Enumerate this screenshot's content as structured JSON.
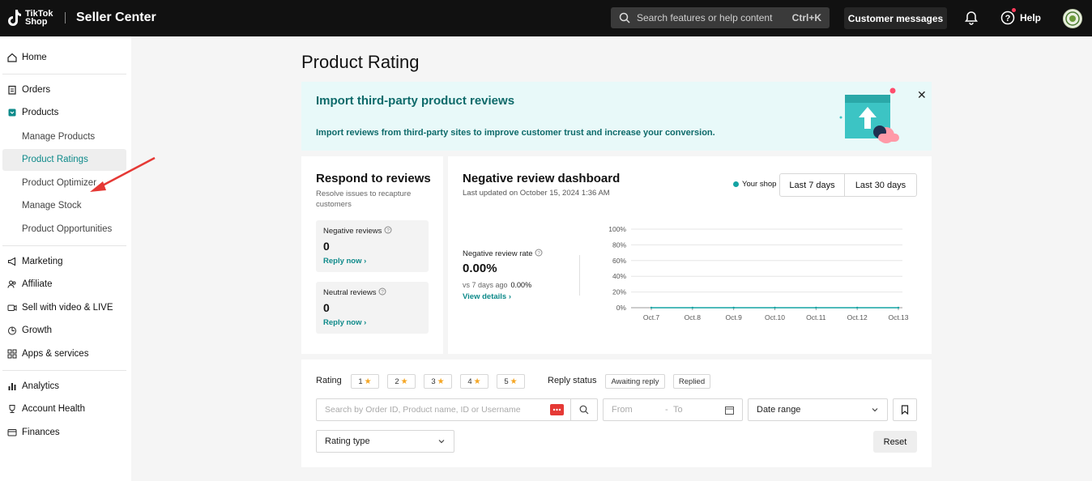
{
  "header": {
    "logo_line1": "TikTok",
    "logo_line2": "Shop",
    "app_title": "Seller Center",
    "search_placeholder": "Search features or help content",
    "search_shortcut": "Ctrl+K",
    "messages_label": "Customer messages",
    "help_label": "Help"
  },
  "sidebar": {
    "home": "Home",
    "orders": "Orders",
    "products": "Products",
    "products_sub": [
      "Manage Products",
      "Product Ratings",
      "Product Optimizer",
      "Manage Stock",
      "Product Opportunities"
    ],
    "marketing": "Marketing",
    "affiliate": "Affiliate",
    "sell_video": "Sell with video & LIVE",
    "growth": "Growth",
    "apps": "Apps & services",
    "analytics": "Analytics",
    "account_health": "Account Health",
    "finances": "Finances",
    "active_color": "#0e8a8a"
  },
  "page": {
    "title": "Product Rating"
  },
  "banner": {
    "title": "Import third-party product reviews",
    "description": "Import reviews from third-party sites to improve customer trust and increase your conversion.",
    "close": "✕"
  },
  "respond": {
    "title": "Respond to reviews",
    "subtitle": "Resolve issues to recapture customers",
    "negative_label": "Negative reviews",
    "negative_count": "0",
    "neutral_label": "Neutral reviews",
    "neutral_count": "0",
    "reply_link": "Reply now"
  },
  "dashboard": {
    "title": "Negative review dashboard",
    "updated": "Last updated on October 15, 2024 1:36 AM",
    "legend": "Your shop",
    "range_7": "Last 7 days",
    "range_30": "Last 30 days",
    "rate_label": "Negative review rate",
    "rate_value": "0.00%",
    "vs_label": "vs 7 days ago",
    "vs_value": "0.00%",
    "details_link": "View details"
  },
  "chart_data": {
    "type": "line",
    "x": [
      "Oct.7",
      "Oct.8",
      "Oct.9",
      "Oct.10",
      "Oct.11",
      "Oct.12",
      "Oct.13"
    ],
    "series": [
      {
        "values": [
          0,
          0,
          0,
          0,
          0,
          0,
          0
        ]
      }
    ],
    "y_ticks": [
      "100%",
      "80%",
      "60%",
      "40%",
      "20%",
      "0%"
    ],
    "ylim": [
      0,
      100
    ],
    "grid": true,
    "color": "#14a3a3"
  },
  "filters": {
    "rating_label": "Rating",
    "ratings": [
      "1",
      "2",
      "3",
      "4",
      "5"
    ],
    "reply_status_label": "Reply status",
    "status_options": [
      "Awaiting reply",
      "Replied"
    ],
    "search_placeholder": "Search by Order ID, Product name, ID or Username",
    "from_placeholder": "From",
    "dash": "-",
    "to_placeholder": "To",
    "date_range": "Date range",
    "rating_type": "Rating type",
    "reset": "Reset"
  }
}
